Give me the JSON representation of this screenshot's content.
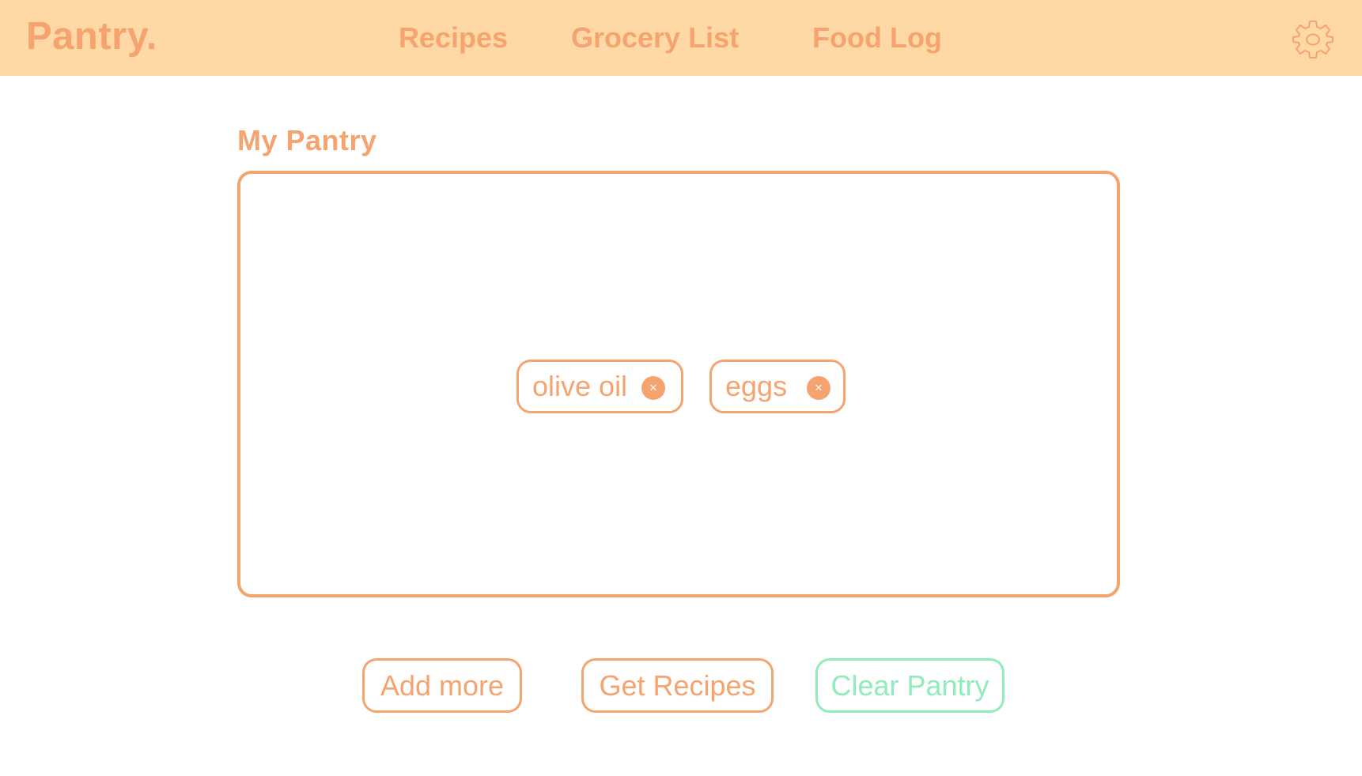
{
  "app": {
    "logo": "Pantry."
  },
  "nav": {
    "items": [
      {
        "label": "Recipes"
      },
      {
        "label": "Grocery List"
      },
      {
        "label": "Food Log"
      }
    ],
    "settings_icon": "gear-icon"
  },
  "pantry": {
    "title": "My Pantry",
    "items": [
      {
        "label": "olive oil",
        "remove_icon": "×"
      },
      {
        "label": "eggs",
        "remove_icon": "×"
      }
    ]
  },
  "actions": {
    "add_more": "Add more",
    "get_recipes": "Get Recipes",
    "clear_pantry": "Clear Pantry"
  },
  "colors": {
    "header_bg": "#FFD9A5",
    "accent": "#F5A46F",
    "clear_accent": "#8EEDBA",
    "background": "#FFFFFF"
  }
}
